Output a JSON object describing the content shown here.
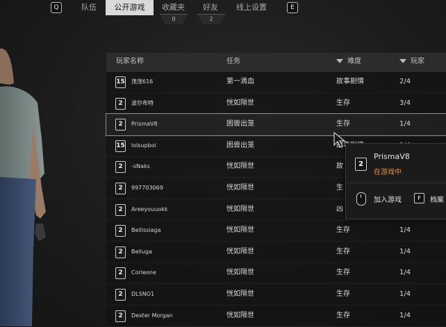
{
  "topnav": {
    "left_key": "Q",
    "right_key": "E",
    "tabs": [
      {
        "label": "队伍"
      },
      {
        "label": "公开游戏"
      },
      {
        "label": "收藏夹"
      },
      {
        "label": "好友"
      },
      {
        "label": "线上设置"
      }
    ],
    "badges": [
      "0",
      "2"
    ]
  },
  "table": {
    "headers": {
      "player": "玩家名称",
      "mission": "任务",
      "difficulty": "难度",
      "players": "玩家"
    },
    "rows": [
      {
        "rank": "15",
        "name": "茂茂616",
        "mission": "第一滴血",
        "difficulty": "故事剧情",
        "players": "2/4"
      },
      {
        "rank": "2",
        "name": "波尔布特",
        "mission": "恍如隔世",
        "difficulty": "生存",
        "players": "3/4"
      },
      {
        "rank": "2",
        "name": "PrismaV8",
        "mission": "困兽出笼",
        "difficulty": "生存",
        "players": "1/4"
      },
      {
        "rank": "15",
        "name": "lolsupboi",
        "mission": "困兽出笼",
        "difficulty": "故事剧情",
        "players": "1/4"
      },
      {
        "rank": "2",
        "name": "-sNaks",
        "mission": "恍如隔世",
        "difficulty": "故",
        "players": ""
      },
      {
        "rank": "2",
        "name": "997703069",
        "mission": "恍如隔世",
        "difficulty": "生",
        "players": ""
      },
      {
        "rank": "2",
        "name": "Areeyouuokk",
        "mission": "恍如隔世",
        "difficulty": "凶",
        "players": ""
      },
      {
        "rank": "2",
        "name": "Bellissiaga",
        "mission": "恍如隔世",
        "difficulty": "生存",
        "players": "1/4"
      },
      {
        "rank": "2",
        "name": "Belluga",
        "mission": "恍如隔世",
        "difficulty": "生存",
        "players": "1/4"
      },
      {
        "rank": "2",
        "name": "Corleone",
        "mission": "恍如隔世",
        "difficulty": "生存",
        "players": "1/4"
      },
      {
        "rank": "2",
        "name": "DLSNO1",
        "mission": "恍如隔世",
        "difficulty": "生存",
        "players": "1/4"
      },
      {
        "rank": "2",
        "name": "Dexter Morgan",
        "mission": "恍如隔世",
        "difficulty": "生存",
        "players": "1/4"
      }
    ]
  },
  "popup": {
    "rank": "2",
    "name": "PrismaV8",
    "status": "在游戏中",
    "join_label": "加入游戏",
    "profile_key": "F",
    "profile_label": "档案"
  },
  "colors": {
    "status_orange": "#e3913c",
    "active_tab_bg": "#d9d9d9"
  }
}
